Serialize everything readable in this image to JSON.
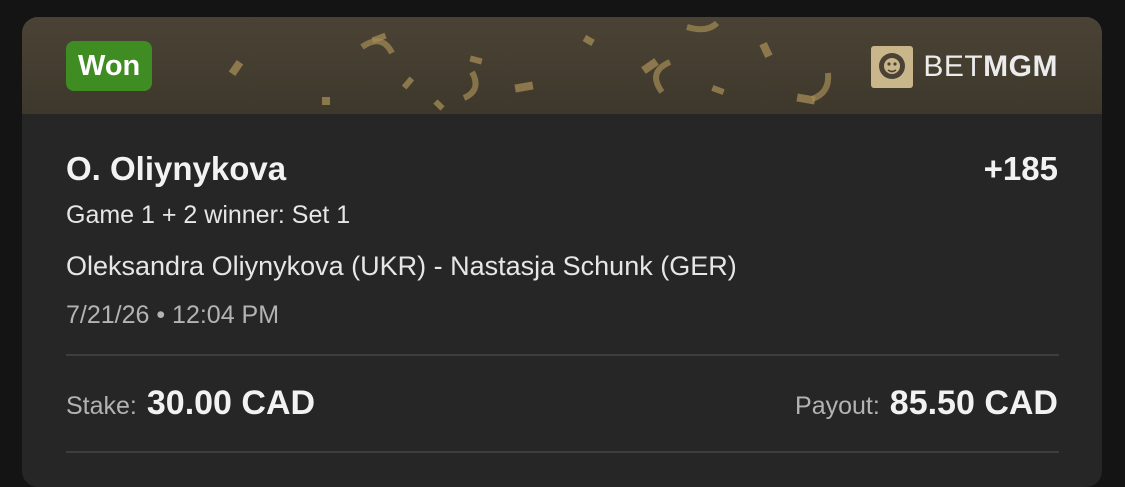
{
  "header": {
    "status_badge": "Won",
    "brand_bet": "BET",
    "brand_mgm": "MGM",
    "brand_logo_icon": "lion-head-icon"
  },
  "bet": {
    "selection": "O. Oliynykova",
    "odds": "+185",
    "market": "Game 1 + 2 winner: Set 1",
    "event": "Oleksandra Oliynykova (UKR) - Nastasja Schunk (GER)",
    "datetime": "7/21/26 • 12:04 PM"
  },
  "totals": {
    "stake_label": "Stake:",
    "stake_value": "30.00 CAD",
    "payout_label": "Payout:",
    "payout_value": "85.50 CAD"
  },
  "colors": {
    "won_green": "#3f8c23",
    "banner_gold": "#4a4335",
    "card_bg": "#262626",
    "confetti": "#b59a5c"
  }
}
